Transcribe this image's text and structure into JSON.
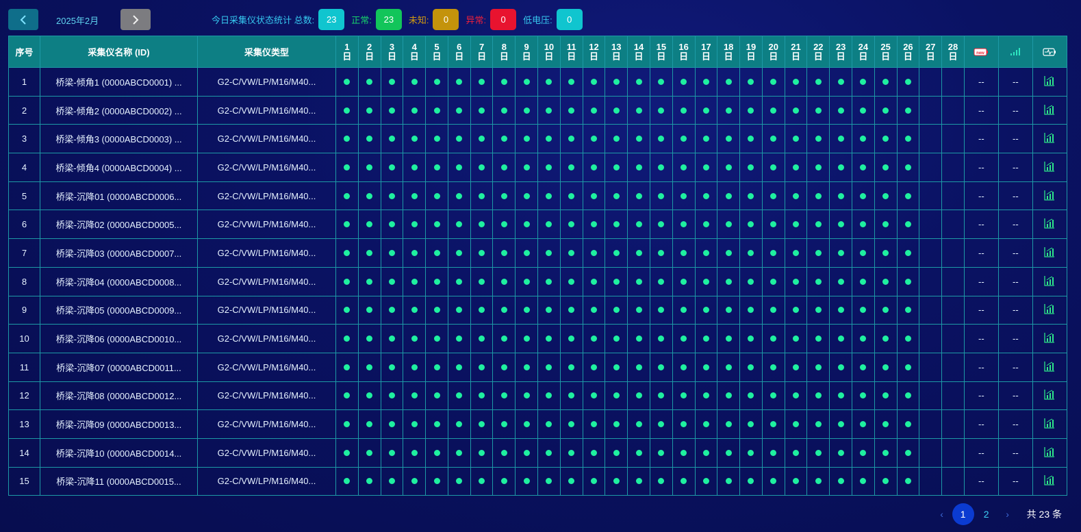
{
  "header": {
    "prev_icon": "chevron-left-icon",
    "next_icon": "chevron-right-icon",
    "month": "2025年2月",
    "stats": [
      {
        "label": "今日采集仪状态统计  总数:",
        "value": "23",
        "label_color": "#36c8ef",
        "badge_color": "#10c5cf"
      },
      {
        "label": "正常:",
        "value": "23",
        "label_color": "#17d36b",
        "badge_color": "#12c55a"
      },
      {
        "label": "未知:",
        "value": "0",
        "label_color": "#d39b0f",
        "badge_color": "#c4930b"
      },
      {
        "label": "异常:",
        "value": "0",
        "label_color": "#f0203a",
        "badge_color": "#e8132f"
      },
      {
        "label": "低电压:",
        "value": "0",
        "label_color": "#36c8ef",
        "badge_color": "#10c5cf"
      }
    ]
  },
  "table": {
    "col_index": "序号",
    "col_name": "采集仪名称 (ID)",
    "col_type": "采集仪类型",
    "day_suffix": "日",
    "days": [
      "1",
      "2",
      "3",
      "4",
      "5",
      "6",
      "7",
      "8",
      "9",
      "10",
      "11",
      "12",
      "13",
      "14",
      "15",
      "16",
      "17",
      "18",
      "19",
      "20",
      "21",
      "22",
      "23",
      "24",
      "25",
      "26",
      "27",
      "28"
    ],
    "battery_icon": "battery-icon",
    "signal_icon": "signal-icon",
    "monitor_icon": "battery-activity-icon",
    "status_color": "#1ff0a0",
    "filled_days": 26,
    "rows": [
      {
        "index": "1",
        "name": "桥梁-倾角1 (0000ABCD0001) ...",
        "type": "G2-C/VW/LP/M16/M40...",
        "battery": "--",
        "signal": "--"
      },
      {
        "index": "2",
        "name": "桥梁-倾角2 (0000ABCD0002) ...",
        "type": "G2-C/VW/LP/M16/M40...",
        "battery": "--",
        "signal": "--"
      },
      {
        "index": "3",
        "name": "桥梁-倾角3 (0000ABCD0003) ...",
        "type": "G2-C/VW/LP/M16/M40...",
        "battery": "--",
        "signal": "--"
      },
      {
        "index": "4",
        "name": "桥梁-倾角4 (0000ABCD0004) ...",
        "type": "G2-C/VW/LP/M16/M40...",
        "battery": "--",
        "signal": "--"
      },
      {
        "index": "5",
        "name": "桥梁-沉降01 (0000ABCD0006...",
        "type": "G2-C/VW/LP/M16/M40...",
        "battery": "--",
        "signal": "--"
      },
      {
        "index": "6",
        "name": "桥梁-沉降02 (0000ABCD0005...",
        "type": "G2-C/VW/LP/M16/M40...",
        "battery": "--",
        "signal": "--"
      },
      {
        "index": "7",
        "name": "桥梁-沉降03 (0000ABCD0007...",
        "type": "G2-C/VW/LP/M16/M40...",
        "battery": "--",
        "signal": "--"
      },
      {
        "index": "8",
        "name": "桥梁-沉降04 (0000ABCD0008...",
        "type": "G2-C/VW/LP/M16/M40...",
        "battery": "--",
        "signal": "--"
      },
      {
        "index": "9",
        "name": "桥梁-沉降05 (0000ABCD0009...",
        "type": "G2-C/VW/LP/M16/M40...",
        "battery": "--",
        "signal": "--"
      },
      {
        "index": "10",
        "name": "桥梁-沉降06 (0000ABCD0010...",
        "type": "G2-C/VW/LP/M16/M40...",
        "battery": "--",
        "signal": "--"
      },
      {
        "index": "11",
        "name": "桥梁-沉降07 (0000ABCD0011...",
        "type": "G2-C/VW/LP/M16/M40...",
        "battery": "--",
        "signal": "--"
      },
      {
        "index": "12",
        "name": "桥梁-沉降08 (0000ABCD0012...",
        "type": "G2-C/VW/LP/M16/M40...",
        "battery": "--",
        "signal": "--"
      },
      {
        "index": "13",
        "name": "桥梁-沉降09 (0000ABCD0013...",
        "type": "G2-C/VW/LP/M16/M40...",
        "battery": "--",
        "signal": "--"
      },
      {
        "index": "14",
        "name": "桥梁-沉降10 (0000ABCD0014...",
        "type": "G2-C/VW/LP/M16/M40...",
        "battery": "--",
        "signal": "--"
      },
      {
        "index": "15",
        "name": "桥梁-沉降11 (0000ABCD0015...",
        "type": "G2-C/VW/LP/M16/M40...",
        "battery": "--",
        "signal": "--"
      }
    ]
  },
  "pagination": {
    "prev_icon": "chevron-left-icon",
    "next_icon": "chevron-right-icon",
    "pages": [
      "1",
      "2"
    ],
    "current": "1",
    "total": "共 23 条"
  }
}
